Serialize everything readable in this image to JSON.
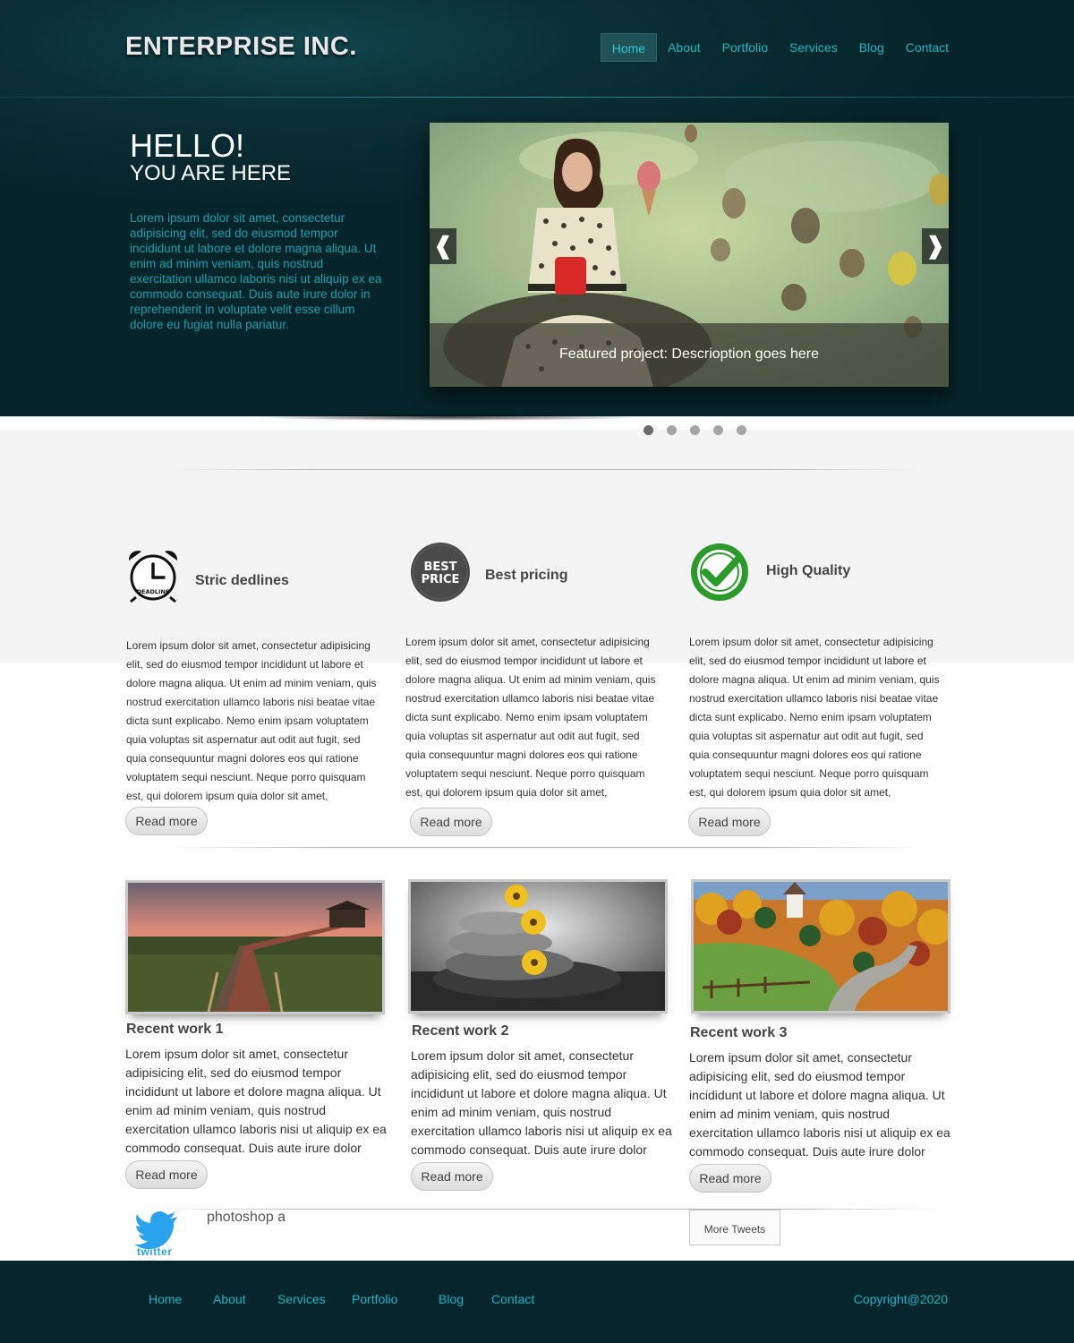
{
  "header": {
    "logo": "ENTERPRISE INC.",
    "nav": [
      "Home",
      "About",
      "Portfolio",
      "Services",
      "Blog",
      "Contact"
    ],
    "active_nav": "Home"
  },
  "hero": {
    "title": "HELLO!",
    "subtitle": "YOU ARE HERE",
    "text": "Lorem ipsum dolor sit amet, consectetur adipisicing elit, sed do eiusmod tempor incididunt ut labore et dolore magna aliqua. Ut enim ad minim veniam, quis nostrud exercitation ullamco laboris nisi ut aliquip ex ea commodo consequat. Duis aute irure dolor in reprehenderit in voluptate velit esse cillum dolore eu fugiat nulla pariatur.",
    "slider": {
      "caption": "Featured project: Descrioption goes here",
      "prev_icon": "chevron-left-icon",
      "next_icon": "chevron-right-icon",
      "prev_glyph": "❰",
      "next_glyph": "❱",
      "dots_count": 5,
      "active_dot": 1
    }
  },
  "features": [
    {
      "icon": "deadline-clock-icon",
      "title": "Stric dedlines",
      "text": "Lorem ipsum dolor sit amet, consectetur adipisicing elit, sed do eiusmod tempor incididunt ut labore et dolore magna aliqua. Ut enim ad minim veniam, quis nostrud exercitation ullamco laboris nisi beatae vitae dicta sunt explicabo. Nemo enim ipsam voluptatem quia voluptas sit aspernatur aut odit aut fugit, sed quia consequuntur magni dolores eos qui ratione voluptatem sequi nesciunt. Neque porro quisquam est, qui dolorem ipsum quia dolor sit amet,",
      "button": "Read more"
    },
    {
      "icon": "best-price-badge-icon",
      "title": "Best pricing",
      "badge_line1": "BEST",
      "badge_line2": "PRICE",
      "text": "Lorem ipsum dolor sit amet, consectetur adipisicing elit, sed do eiusmod tempor incididunt ut labore et dolore magna aliqua. Ut enim ad minim veniam, quis nostrud exercitation ullamco laboris nisi beatae vitae dicta sunt explicabo. Nemo enim ipsam voluptatem quia voluptas sit aspernatur aut odit aut fugit, sed quia consequuntur magni dolores eos qui ratione voluptatem sequi nesciunt. Neque porro quisquam est, qui dolorem ipsum quia dolor sit amet,",
      "button": "Read more"
    },
    {
      "icon": "high-quality-check-icon",
      "title": "High Quality",
      "text": "Lorem ipsum dolor sit amet, consectetur adipisicing elit, sed do eiusmod tempor incididunt ut labore et dolore magna aliqua. Ut enim ad minim veniam, quis nostrud exercitation ullamco laboris nisi beatae vitae dicta sunt explicabo. Nemo enim ipsam voluptatem quia voluptas sit aspernatur aut odit aut fugit, sed quia consequuntur magni dolores eos qui ratione voluptatem sequi nesciunt. Neque porro quisquam est, qui dolorem ipsum quia dolor sit amet,",
      "button": "Read more"
    }
  ],
  "works": [
    {
      "image": "boardwalk-sunset-photo",
      "title": "Recent work 1",
      "text": "Lorem ipsum dolor sit amet, consectetur adipisicing elit, sed do eiusmod tempor incididunt ut labore et dolore magna aliqua. Ut enim ad minim veniam, quis nostrud exercitation ullamco laboris nisi ut aliquip ex ea commodo consequat. Duis aute irure dolor",
      "button": "Read more"
    },
    {
      "image": "stones-flowers-photo",
      "title": "Recent work 2",
      "text": "Lorem ipsum dolor sit amet, consectetur adipisicing elit, sed do eiusmod tempor incididunt ut labore et dolore magna aliqua. Ut enim ad minim veniam, quis nostrud exercitation ullamco laboris nisi ut aliquip ex ea commodo consequat. Duis aute irure dolor",
      "button": "Read more"
    },
    {
      "image": "autumn-chapel-photo",
      "title": "Recent work 3",
      "text": "Lorem ipsum dolor sit amet, consectetur adipisicing elit, sed do eiusmod tempor incididunt ut labore et dolore magna aliqua. Ut enim ad minim veniam, quis nostrud exercitation ullamco laboris nisi ut aliquip ex ea commodo consequat. Duis aute irure dolor",
      "button": "Read more"
    }
  ],
  "twitter": {
    "icon": "twitter-bird-icon",
    "wordmark": "twitter",
    "tweet": "photoshop a",
    "more_button": "More Tweets"
  },
  "footer": {
    "nav": [
      "Home",
      "About",
      "Services",
      "Portfolio",
      "Blog",
      "Contact"
    ],
    "copyright": "Copyright@2020"
  },
  "colors": {
    "hero_bg": "#06252a",
    "accent": "#1fb5c9",
    "footer_bg": "#06262b"
  }
}
